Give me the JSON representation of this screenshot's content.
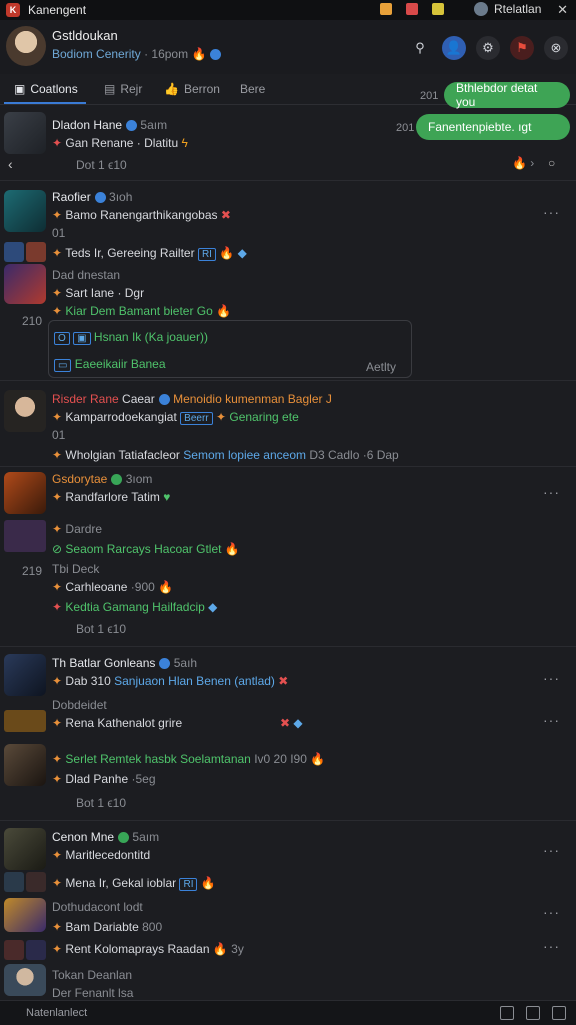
{
  "window": {
    "title": "Kanengent",
    "right_label": "Rtelatlan"
  },
  "header": {
    "name": "Gstldoukan",
    "subtitle": "Bodiom Cenerity",
    "time": "· 16pom"
  },
  "tabs": [
    {
      "label": "Coatlons"
    },
    {
      "label": "Rejr"
    },
    {
      "label": "Berron"
    },
    {
      "label": "Bere"
    }
  ],
  "chat": [
    {
      "time": "201",
      "text": "Bthlebdor detat you"
    },
    {
      "time": "201",
      "text": "Fanentenpiebte. ıgt"
    }
  ],
  "post0": {
    "name": "Dladon Hane",
    "time": "5aım",
    "line1": "Gan Renane · Dlatitu",
    "line2": "Dot 1 ϵ10"
  },
  "post1": {
    "name": "Raofier",
    "time": "3ıoh",
    "line1": "Bamo Ranengarthikangobas",
    "line1b": "01",
    "line2": "Teds  Ir, Gereeing Railter",
    "tag": "RI",
    "line3": "Dad dnestan",
    "line4": "Sart Iane · Dgr",
    "line5": "Kiar Dem Bamant bieter Go",
    "time2": "210",
    "quote1": "Hsnan Ik (Ka joauer))",
    "quote2": "Eaeeikaiir Banea",
    "quote_label": "Aetlty"
  },
  "post2": {
    "name": "Risder Rane",
    "name2": "Caear",
    "line0": "Menoidio kumenman Bagler J",
    "line1": "Kamparrodoekangiat",
    "tag": "Beerr",
    "line1b": "Genaring ete",
    "line1c": "01",
    "line2": "Wholgian Tatiafacleor",
    "line2b": "Semom lopiee anceom",
    "line2c": "D3 Cadlo ·6 Dap"
  },
  "post3": {
    "name": "Gsdorytae",
    "time": "3ıom",
    "line1": "Randfarlore Tatim",
    "line2": "Dardre",
    "line3": "Seaom Rarcays Hacoar Gtlet",
    "line4": "Tbi Deck",
    "time2": "219",
    "line5": "Carhleoane",
    "line5b": "·900",
    "line6": "Kedtia Gamang Hailfadcip",
    "stat": "Bot 1 ϵ10"
  },
  "post4": {
    "name": "Th Batlar Gonleans",
    "time": "5aıh",
    "line1": "Dab 310",
    "line1b": "Sanjuaon Hlan Benen (antlad)",
    "line2": "Dobdeidet",
    "line3": "Rena Kathenalot grire",
    "line4": "Serlet Remtek hasbk Soelamtanan",
    "nums": "Iv0  20  I90",
    "line5": "Dlad Panhe",
    "line5b": "·5eg",
    "stat": "Bot 1 ϵ10"
  },
  "post5": {
    "name": "Cenon Mne",
    "time": "5aım",
    "line1": "Maritlecedontitd",
    "line2": "Mena  Ir, Gekal ioblar",
    "tag": "RI",
    "line3": "Dothudacont lodt",
    "line4": "Bam Dariabte",
    "line4b": "800",
    "line5": "Rent Kolomaprays Raadan",
    "line5b": "3y",
    "line6": "Tokan Deanlan",
    "line7": "Der Fenanlt lsa"
  },
  "footer": {
    "text": "Natenlanlect"
  }
}
